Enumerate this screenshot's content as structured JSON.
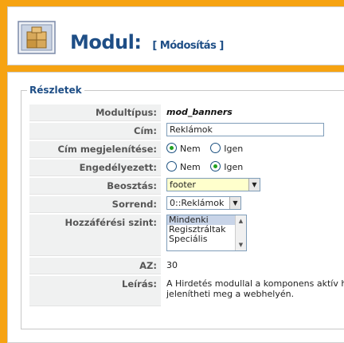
{
  "header": {
    "title": "Modul:",
    "subtitle": "[ Módosítás ]",
    "icon": "module-box-icon"
  },
  "details": {
    "legend": "Részletek",
    "module_type": {
      "label": "Modultípus:",
      "value": "mod_banners"
    },
    "title_field": {
      "label": "Cím:",
      "value": "Reklámok"
    },
    "show_title": {
      "label": "Cím megjelenítése:",
      "options": [
        {
          "label": "Nem",
          "checked": true
        },
        {
          "label": "Igen",
          "checked": false
        }
      ]
    },
    "enabled": {
      "label": "Engedélyezett:",
      "options": [
        {
          "label": "Nem",
          "checked": false
        },
        {
          "label": "Igen",
          "checked": true
        }
      ]
    },
    "position": {
      "label": "Beosztás:",
      "value": "footer"
    },
    "order": {
      "label": "Sorrend:",
      "value": "0::Reklámok"
    },
    "access": {
      "label": "Hozzáférési szint:",
      "options": [
        "Mindenki",
        "Regisztráltak",
        "Speciális"
      ],
      "selected": "Mindenki"
    },
    "id": {
      "label": "AZ:",
      "value": "30"
    },
    "description": {
      "label": "Leírás:",
      "line1": "A Hirdetés modullal a komponens aktív hir",
      "line2": "jelenítheti meg a webhelyén."
    }
  }
}
